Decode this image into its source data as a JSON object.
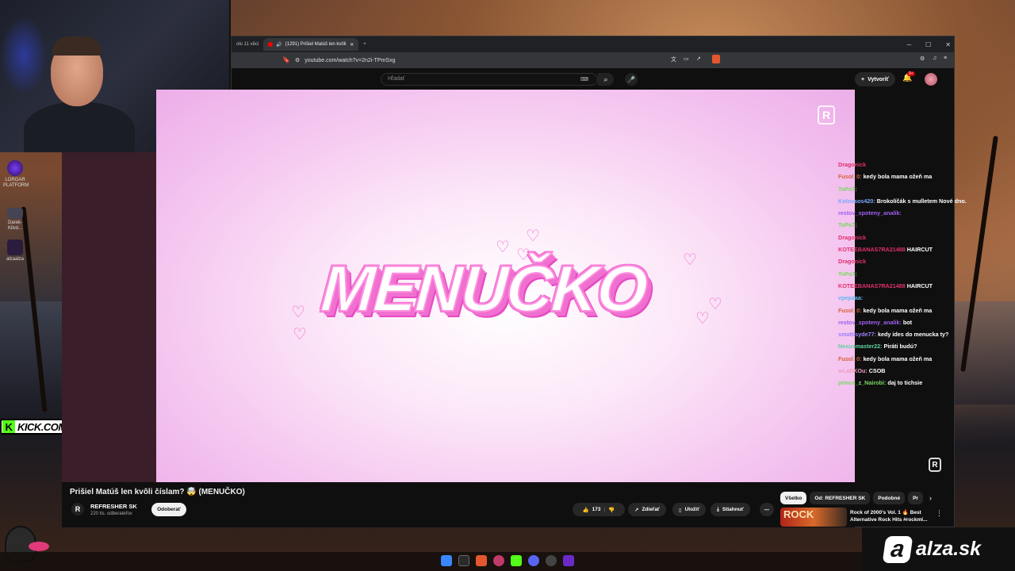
{
  "browser": {
    "tabs": [
      {
        "label": "olo 11 věci",
        "active": false
      },
      {
        "label": "(1291) Prišiel Matúš len kvôli",
        "active": true
      }
    ],
    "new_tab": "+",
    "url": "youtube.com/watch?v=2n2i-TPmSxg"
  },
  "youtube": {
    "search_placeholder": "Hľadať",
    "create_label": "Vytvoriť",
    "notif_count": "9+",
    "video_title": "Prišiel Matúš len kvôli číslam? 🤯 (MENUČKO)",
    "channel": {
      "name": "REFRESHER SK",
      "subs": "220 tis. odberateľov",
      "subscribe": "Odoberať"
    },
    "actions": {
      "likes": "173",
      "share": "Zdieľať",
      "save": "Uložiť",
      "download": "Stiahnuť"
    },
    "chips": [
      "Všetko",
      "Od: REFRESHER SK",
      "Podobné",
      "Pr"
    ],
    "recommendation": {
      "title": "Rock of 2000's Vol. 1 🔥 Best Alternative Rock Hits #rockml...",
      "thumb_text": "ROCK"
    }
  },
  "player": {
    "title_text": "MENUČKO",
    "logo": "R"
  },
  "chat": [
    {
      "user": "Dragonick",
      "msg": "",
      "color": "#e0306a"
    },
    {
      "user": "Fusol_0:",
      "msg": "kedy bola mama ožeň ma",
      "color": "#d4603a"
    },
    {
      "user": "ToPo7:",
      "msg": "",
      "color": "#7ad860"
    },
    {
      "user": "Kolossos420:",
      "msg": "Brokolíčák s mulletem Nové dno.",
      "color": "#7aa8ff"
    },
    {
      "user": "restov_spoteny_analik:",
      "msg": "",
      "color": "#a060f0"
    },
    {
      "user": "ToPo7:",
      "msg": "",
      "color": "#7ad860"
    },
    {
      "user": "Dragonick",
      "msg": "",
      "color": "#e0306a"
    },
    {
      "user": "KOTEEBANAS7RA21488",
      "msg": "HAIRCUT",
      "color": "#e0306a"
    },
    {
      "user": "Dragonick",
      "msg": "",
      "color": "#e0306a"
    },
    {
      "user": "ToPo7:",
      "msg": "",
      "color": "#7ad860"
    },
    {
      "user": "KOTEEBANAS7RA21488",
      "msg": "HAIRCUT",
      "color": "#e0306a"
    },
    {
      "user": "vpepaaa:",
      "msg": "",
      "color": "#60b8f0"
    },
    {
      "user": "Fusol_0:",
      "msg": "kedy bola mama ožeň ma",
      "color": "#d4603a"
    },
    {
      "user": "restov_spoteny_analik:",
      "msg": "bot",
      "color": "#a060f0"
    },
    {
      "user": "smattisyde77:",
      "msg": "kedy ides do menucka ty?",
      "color": "#a080ff"
    },
    {
      "user": "Nexusmaster22:",
      "msg": "Piráti budú?",
      "color": "#60d0a0"
    },
    {
      "user": "Fusol_0:",
      "msg": "kedy bola mama ožeň ma",
      "color": "#d4603a"
    },
    {
      "user": "wLaBKOu:",
      "msg": "CSOB",
      "color": "#f0a0c0"
    },
    {
      "user": "prince_z_Nairobi:",
      "msg": "daj to tichsie",
      "color": "#7ad860"
    }
  ],
  "desktop": {
    "icons": [
      {
        "label": "LORGAR PLATFORM"
      },
      {
        "label": "Darek-Kilvd..."
      },
      {
        "label": "alzaalza"
      }
    ],
    "kick_banner": "KICK.COM/RESTT",
    "kick_letter": "K"
  },
  "alza": {
    "logo_letter": "a",
    "text": "alza.sk"
  },
  "colors": {
    "accent_pink": "#f070d0",
    "kick_green": "#53fc18",
    "yt_bg": "#0f0f0f"
  }
}
